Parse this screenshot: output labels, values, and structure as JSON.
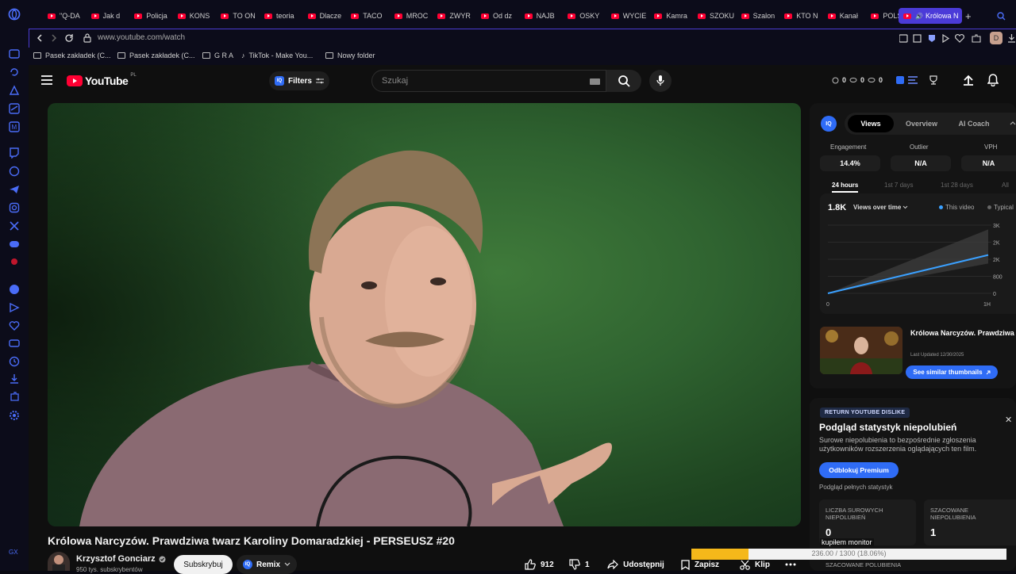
{
  "browser": {
    "tabs": [
      {
        "label": "\"Q-DA"
      },
      {
        "label": "Jak d"
      },
      {
        "label": "Policja"
      },
      {
        "label": "KONS"
      },
      {
        "label": "TO ON"
      },
      {
        "label": "teoria"
      },
      {
        "label": "Dlacze"
      },
      {
        "label": "TACO"
      },
      {
        "label": "MROC"
      },
      {
        "label": "ZWYR"
      },
      {
        "label": "Od dz"
      },
      {
        "label": "NAJB"
      },
      {
        "label": "OSKY"
      },
      {
        "label": "WYCIE"
      },
      {
        "label": "Kamra"
      },
      {
        "label": "SZOKU"
      },
      {
        "label": "Szalon"
      },
      {
        "label": "KTO N"
      },
      {
        "label": "Kanał"
      },
      {
        "label": "POLSK"
      }
    ],
    "active_tab": "Królowa N",
    "url": "www.youtube.com/watch",
    "profile_initial": "D",
    "bookmarks": [
      {
        "label": "Pasek zakładek (C..."
      },
      {
        "label": "Pasek zakładek (C..."
      },
      {
        "label": "G R A"
      },
      {
        "label": "TikTok - Make You..."
      },
      {
        "label": "Nowy folder"
      }
    ]
  },
  "youtube": {
    "logo": "YouTube",
    "region": "PL",
    "filters_label": "Filters",
    "search_placeholder": "Szukaj",
    "header_stats": {
      "a": "0",
      "b": "0",
      "c": "0"
    },
    "title": "Królowa Narcyzów. Prawdziwa twarz Karoliny Domaradzkiej - PERSEUSZ #20",
    "channel": "Krzysztof Gonciarz",
    "subscribers": "950 tys. subskrybentów",
    "subscribe_label": "Subskrybuj",
    "remix_label": "Remix",
    "likes": "912",
    "dislikes": "1",
    "share_label": "Udostępnij",
    "save_label": "Zapisz",
    "clip_label": "Klip"
  },
  "vidiq": {
    "tabs": [
      "Views",
      "Overview",
      "AI Coach"
    ],
    "metrics": [
      {
        "label": "Engagement",
        "value": "14.4%"
      },
      {
        "label": "Outlier",
        "value": "N/A"
      },
      {
        "label": "VPH",
        "value": "N/A"
      }
    ],
    "ranges": [
      "24 hours",
      "1st 7 days",
      "1st 28 days",
      "All"
    ],
    "views_total": "1.8K",
    "views_dropdown": "Views over time",
    "legend_this": "This video",
    "legend_typical": "Typical",
    "similar_title": "Królowa Narcyzów. Prawdziwa twarz Karoliny Domaradzkiej",
    "last_updated": "Last Updated 12/30/2025",
    "similar_button": "See similar thumbnails"
  },
  "chart_data": {
    "type": "line",
    "x": [
      "0",
      "1H"
    ],
    "series": [
      {
        "name": "This video",
        "values": [
          0,
          1800
        ]
      }
    ],
    "typical_band": {
      "low": [
        0,
        1400
      ],
      "high": [
        0,
        3000
      ]
    },
    "y_ticks": [
      "3K",
      "2K",
      "2K",
      "800",
      "0"
    ],
    "ylim": [
      0,
      3200
    ]
  },
  "ryd": {
    "badge": "RETURN YOUTUBE DISLIKE",
    "title": "Podgląd statystyk niepolubień",
    "desc": "Surowe niepolubienia to bezpośrednie zgłoszenia użytkowników rozszerzenia oglądających ten film.",
    "unlock": "Odblokuj Premium",
    "preview": "Podgląd pełnych statystyk",
    "raw_label": "LICZBA SUROWYCH NIEPOLUBIEŃ",
    "raw_value": "0",
    "est_label": "SZACOWANE NIEPOLUBIENIA",
    "est_value": "1",
    "est_likes_label": "SZACOWANE POLUBIENIA"
  },
  "overlay": {
    "progress_text": "236.00 / 1300 (18.06%)",
    "progress_fraction": 0.1806,
    "note": "kupiłem monitor"
  },
  "colors": {
    "accent": "#4b3bd8",
    "yt_red": "#ff0033",
    "vidiq_blue": "#2f6cf6",
    "progress": "#f5b81a"
  }
}
